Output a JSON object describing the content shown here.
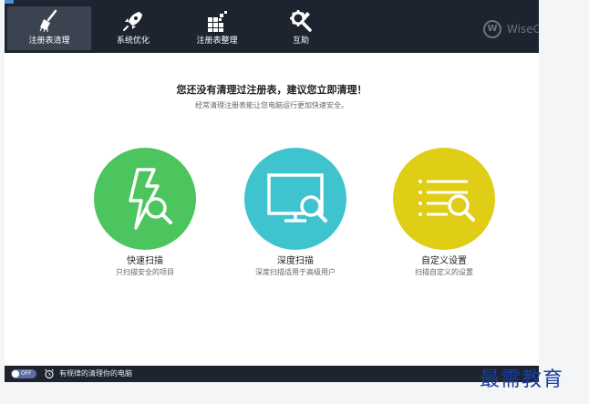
{
  "toolbar": {
    "tabs": [
      {
        "label": "注册表清理",
        "icon": "broom-icon"
      },
      {
        "label": "系统优化",
        "icon": "rocket-icon"
      },
      {
        "label": "注册表整理",
        "icon": "defrag-blocks-icon"
      },
      {
        "label": "互助",
        "icon": "tools-gear-icon"
      }
    ],
    "active_tab": "注册表清理",
    "brand": {
      "letter": "W",
      "text": "WiseC"
    }
  },
  "main": {
    "heading": "您还没有清理过注册表，建议您立即清理！",
    "subheading": "经常清理注册表能让您电脑运行更加快速安全。"
  },
  "scans": [
    {
      "title": "快速扫描",
      "desc": "只扫描安全的项目",
      "color": "#4cc55e",
      "icon": "quick-scan-icon"
    },
    {
      "title": "深度扫描",
      "desc": "深度扫描适用于高级用户",
      "color": "#3fc4cf",
      "icon": "deep-scan-icon"
    },
    {
      "title": "自定义设置",
      "desc": "扫描自定义的设置",
      "color": "#e0cd16",
      "icon": "custom-settings-icon"
    }
  ],
  "statusbar": {
    "toggle_state": "OFF",
    "text": "有规律的清理你的电脑"
  },
  "watermark": "最需教育",
  "colors": {
    "toolbar_bg": "#1d2430",
    "active_tab_bg": "#3b4350",
    "quick": "#4cc55e",
    "deep": "#3fc4cf",
    "custom": "#e0cd16"
  }
}
